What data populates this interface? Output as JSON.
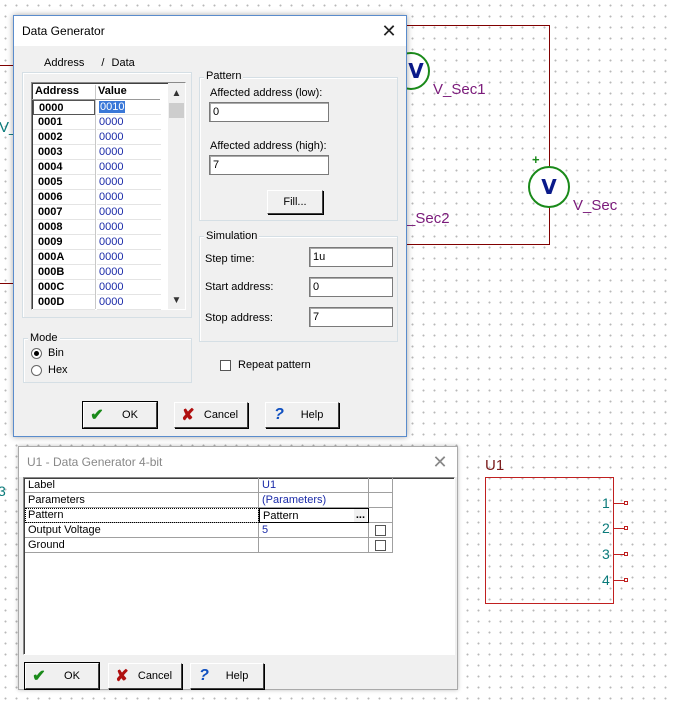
{
  "schematic": {
    "meter_glyph": "V",
    "meter1_label": "V_Sec1",
    "meter2_label": "V_Sec",
    "meter2_plus": "+",
    "partial_label_sec2": "_Sec2",
    "partial_label_v": "V_",
    "partial_label_3": "3",
    "u1_title": "U1",
    "u1_pins": [
      "1",
      "2",
      "3",
      "4"
    ],
    "wire_color": "#800000",
    "meter_ring_color": "#1a8a1a"
  },
  "data_generator": {
    "title": "Data Generator",
    "tab_address": "Address",
    "tab_sep": "/",
    "tab_data": "Data",
    "table": {
      "col_address": "Address",
      "col_value": "Value",
      "rows": [
        {
          "addr": "0000",
          "value": "0010"
        },
        {
          "addr": "0001",
          "value": "0000"
        },
        {
          "addr": "0002",
          "value": "0000"
        },
        {
          "addr": "0003",
          "value": "0000"
        },
        {
          "addr": "0004",
          "value": "0000"
        },
        {
          "addr": "0005",
          "value": "0000"
        },
        {
          "addr": "0006",
          "value": "0000"
        },
        {
          "addr": "0007",
          "value": "0000"
        },
        {
          "addr": "0008",
          "value": "0000"
        },
        {
          "addr": "0009",
          "value": "0000"
        },
        {
          "addr": "000A",
          "value": "0000"
        },
        {
          "addr": "000B",
          "value": "0000"
        },
        {
          "addr": "000C",
          "value": "0000"
        },
        {
          "addr": "000D",
          "value": "0000"
        }
      ]
    },
    "pattern": {
      "group_label": "Pattern",
      "low_label": "Affected address (low):",
      "low_value": "0",
      "high_label": "Affected address (high):",
      "high_value": "7",
      "fill_label": "Fill..."
    },
    "simulation": {
      "group_label": "Simulation",
      "step_label": "Step time:",
      "step_value": "1u",
      "start_label": "Start address:",
      "start_value": "0",
      "stop_label": "Stop address:",
      "stop_value": "7"
    },
    "mode": {
      "group_label": "Mode",
      "bin": "Bin",
      "hex": "Hex",
      "selected": "Bin"
    },
    "repeat_label": "Repeat pattern",
    "ok": "OK",
    "cancel": "Cancel",
    "help": "Help"
  },
  "props_dialog": {
    "title": "U1 - Data Generator 4-bit",
    "rows": [
      {
        "name": "Label",
        "value": "U1",
        "blue": true,
        "checkbox": false,
        "ellipsis": false
      },
      {
        "name": "Parameters",
        "value": "(Parameters)",
        "blue": true,
        "checkbox": false,
        "ellipsis": false
      },
      {
        "name": "Pattern",
        "value": "Pattern",
        "blue": false,
        "checkbox": false,
        "ellipsis": true
      },
      {
        "name": "Output Voltage",
        "value": "5",
        "blue": true,
        "checkbox": true,
        "ellipsis": false
      },
      {
        "name": "Ground",
        "value": "",
        "blue": false,
        "checkbox": true,
        "ellipsis": false
      }
    ],
    "ellipsis_glyph": "...",
    "ok": "OK",
    "cancel": "Cancel",
    "help": "Help"
  }
}
